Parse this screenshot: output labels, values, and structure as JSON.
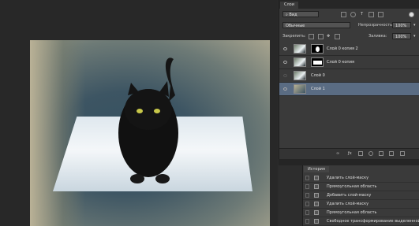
{
  "layers_panel": {
    "tab": "Слои",
    "kind_filter": "Вид",
    "blend_mode": "Обычные",
    "opacity_label": "Непрозрачность:",
    "opacity_value": "100%",
    "lock_label": "Закрепить:",
    "fill_label": "Заливка:",
    "fill_value": "100%",
    "layers": [
      {
        "name": "Слой 0 копия 2",
        "has_mask": true,
        "selected": false
      },
      {
        "name": "Слой 0 копия",
        "has_mask": true,
        "selected": false
      },
      {
        "name": "Слой 0",
        "has_mask": false,
        "selected": false
      },
      {
        "name": "Слой 1",
        "has_mask": false,
        "selected": true
      }
    ],
    "bottom_icons": [
      "link-icon",
      "fx-icon",
      "mask-icon",
      "adjustment-icon",
      "folder-icon",
      "new-layer-icon",
      "trash-icon"
    ]
  },
  "history_panel": {
    "tab": "История",
    "items": [
      "Удалить слой-маску",
      "Прямоугольная область",
      "Добавить слой-маску",
      "Удалить слой-маску",
      "Прямоугольная область",
      "Свободное трансформирование выделенной области"
    ]
  }
}
